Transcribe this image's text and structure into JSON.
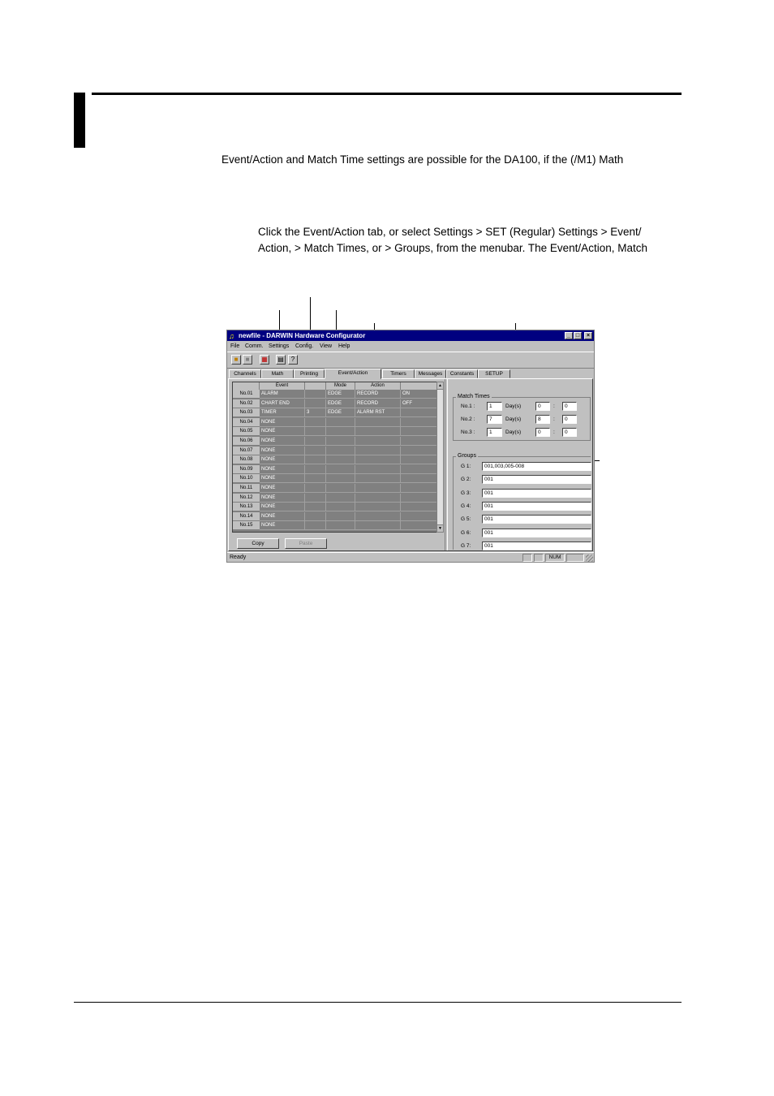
{
  "intro": "Event/Action and Match Time settings are possible for the DA100, if  the (/M1) Math",
  "instruction_line1": "Click the Event/Action tab, or select Settings > SET (Regular) Settings > Event/",
  "instruction_line2": "Action, > Match Times, or  > Groups, from the menubar. The Event/Action, Match",
  "window": {
    "title": "newfile - DARWIN Hardware Configurator",
    "menu": [
      "File",
      "Comm.",
      "Settings",
      "Config.",
      "View",
      "Help"
    ],
    "tabs": [
      "Channels",
      "Math",
      "Printing",
      "Event/Action",
      "Timers",
      "Messages",
      "Constants",
      "SETUP"
    ],
    "table": {
      "headers": [
        "",
        "Event",
        "",
        "Mode",
        "Action",
        ""
      ],
      "rows": [
        {
          "no": "No.01",
          "event": "ALARM",
          "num": "",
          "mode": "EDGE",
          "action": "RECORD",
          "extra": "ON"
        },
        {
          "no": "No.02",
          "event": "CHART END",
          "num": "",
          "mode": "EDGE",
          "action": "RECORD",
          "extra": "OFF"
        },
        {
          "no": "No.03",
          "event": "TIMER",
          "num": "3",
          "mode": "EDGE",
          "action": "ALARM RST",
          "extra": ""
        },
        {
          "no": "No.04",
          "event": "NONE",
          "num": "",
          "mode": "",
          "action": "",
          "extra": ""
        },
        {
          "no": "No.05",
          "event": "NONE",
          "num": "",
          "mode": "",
          "action": "",
          "extra": ""
        },
        {
          "no": "No.06",
          "event": "NONE",
          "num": "",
          "mode": "",
          "action": "",
          "extra": ""
        },
        {
          "no": "No.07",
          "event": "NONE",
          "num": "",
          "mode": "",
          "action": "",
          "extra": ""
        },
        {
          "no": "No.08",
          "event": "NONE",
          "num": "",
          "mode": "",
          "action": "",
          "extra": ""
        },
        {
          "no": "No.09",
          "event": "NONE",
          "num": "",
          "mode": "",
          "action": "",
          "extra": ""
        },
        {
          "no": "No.10",
          "event": "NONE",
          "num": "",
          "mode": "",
          "action": "",
          "extra": ""
        },
        {
          "no": "No.11",
          "event": "NONE",
          "num": "",
          "mode": "",
          "action": "",
          "extra": ""
        },
        {
          "no": "No.12",
          "event": "NONE",
          "num": "",
          "mode": "",
          "action": "",
          "extra": ""
        },
        {
          "no": "No.13",
          "event": "NONE",
          "num": "",
          "mode": "",
          "action": "",
          "extra": ""
        },
        {
          "no": "No.14",
          "event": "NONE",
          "num": "",
          "mode": "",
          "action": "",
          "extra": ""
        },
        {
          "no": "No.15",
          "event": "NONE",
          "num": "",
          "mode": "",
          "action": "",
          "extra": ""
        }
      ]
    },
    "copy_label": "Copy",
    "paste_label": "Paste",
    "match_times": {
      "label": "Match Times",
      "rows": [
        {
          "label": "No.1 :",
          "day": "1",
          "unit": "Day(s)",
          "hour": "0",
          "sep": ":",
          "min": "0"
        },
        {
          "label": "No.2 :",
          "day": "7",
          "unit": "Day(s)",
          "hour": "8",
          "sep": ":",
          "min": "0"
        },
        {
          "label": "No.3 :",
          "day": "1",
          "unit": "Day(s)",
          "hour": "0",
          "sep": ":",
          "min": "0"
        }
      ]
    },
    "groups": {
      "label": "Groups",
      "rows": [
        {
          "label": "G 1:",
          "value": "001,003,005-008"
        },
        {
          "label": "G 2:",
          "value": "001"
        },
        {
          "label": "G 3:",
          "value": "001"
        },
        {
          "label": "G 4:",
          "value": "001"
        },
        {
          "label": "G 5:",
          "value": "001"
        },
        {
          "label": "G 6:",
          "value": "001"
        },
        {
          "label": "G 7:",
          "value": "001"
        }
      ]
    },
    "status": {
      "ready": "Ready",
      "num": "NUM"
    }
  }
}
